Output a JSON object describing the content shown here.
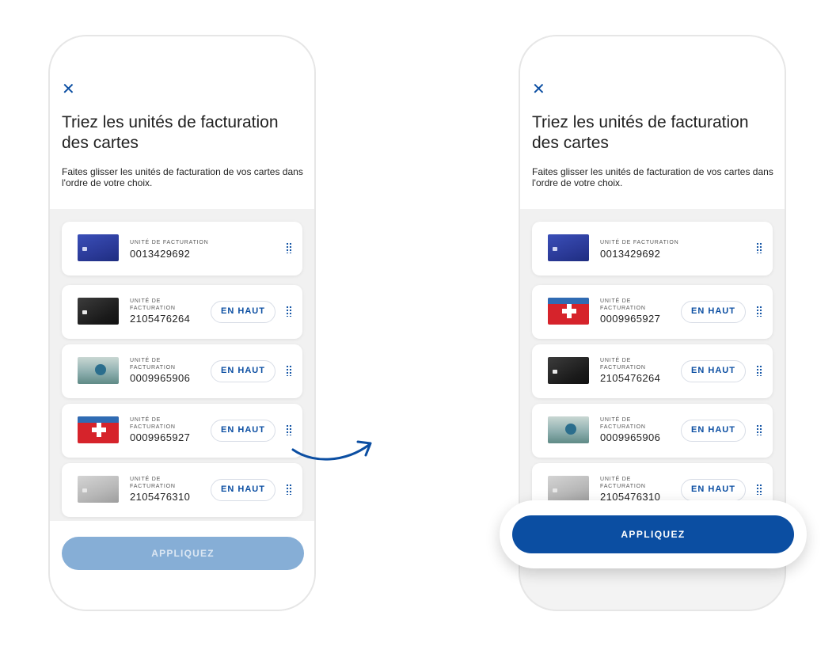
{
  "close_glyph": "✕",
  "left": {
    "title": "Triez les unités de facturation des cartes",
    "subtitle": "Faites glisser les unités de facturation de vos cartes dans l'ordre de votre choix.",
    "cards": [
      {
        "label": "UNITÉ DE FACTURATION",
        "number": "0013429692",
        "card_icon": "blue-card-icon",
        "show_top_button": false
      },
      {
        "label_line1": "UNITÉ DE",
        "label_line2": "FACTURATION",
        "number": "2105476264",
        "card_icon": "black-card-icon",
        "show_top_button": true
      },
      {
        "label_line1": "UNITÉ DE",
        "label_line2": "FACTURATION",
        "number": "0009965906",
        "card_icon": "bird-card-icon",
        "show_top_button": true
      },
      {
        "label_line1": "UNITÉ DE",
        "label_line2": "FACTURATION",
        "number": "0009965927",
        "card_icon": "swiss-flag-card-icon",
        "show_top_button": true
      },
      {
        "label_line1": "UNITÉ DE",
        "label_line2": "FACTURATION",
        "number": "2105476310",
        "card_icon": "silver-card-icon",
        "show_top_button": true
      }
    ],
    "top_button_label": "EN HAUT",
    "apply_label": "APPLIQUEZ",
    "apply_state": "disabled"
  },
  "right": {
    "title": "Triez les unités de facturation des cartes",
    "subtitle": "Faites glisser les unités de facturation de vos cartes dans l'ordre de votre choix.",
    "cards": [
      {
        "label": "UNITÉ DE FACTURATION",
        "number": "0013429692",
        "card_icon": "blue-card-icon",
        "show_top_button": false
      },
      {
        "label_line1": "UNITÉ DE",
        "label_line2": "FACTURATION",
        "number": "0009965927",
        "card_icon": "swiss-flag-card-icon",
        "show_top_button": true
      },
      {
        "label_line1": "UNITÉ DE",
        "label_line2": "FACTURATION",
        "number": "2105476264",
        "card_icon": "black-card-icon",
        "show_top_button": true
      },
      {
        "label_line1": "UNITÉ DE",
        "label_line2": "FACTURATION",
        "number": "0009965906",
        "card_icon": "bird-card-icon",
        "show_top_button": true
      },
      {
        "label_line1": "UNITÉ DE",
        "label_line2": "FACTURATION",
        "number": "2105476310",
        "card_icon": "silver-card-icon",
        "show_top_button": true
      }
    ],
    "top_button_label": "EN HAUT",
    "apply_label": "APPLIQUEZ",
    "apply_state": "enabled"
  },
  "colors": {
    "accent": "#0b4ea2",
    "accent_disabled": "#86aed6"
  },
  "icons": {
    "close": "close-icon",
    "drag": "drag-handle-icon",
    "transition": "curved-arrow-icon"
  }
}
